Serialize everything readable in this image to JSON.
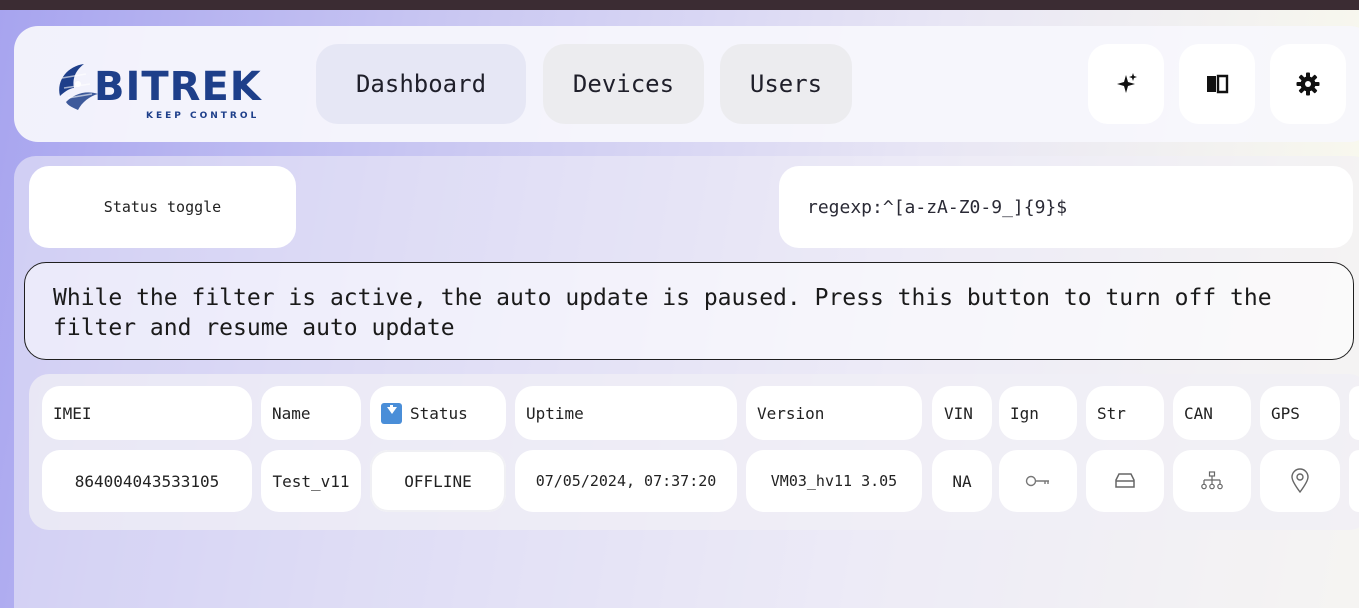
{
  "app": {
    "logo_text": "BITREK",
    "logo_tagline": "KEEP CONTROL",
    "brand_color": "#1e3f8a"
  },
  "nav": {
    "dashboard_label": "Dashboard",
    "devices_label": "Devices",
    "users_label": "Users",
    "icons": [
      "sparkle-icon",
      "book-icon",
      "gear-icon"
    ]
  },
  "filters": {
    "status_toggle_label": "Status toggle",
    "search_value": "regexp:^[a-zA-Z0-9_]{9}$"
  },
  "notice": {
    "text": "While the filter is active, the auto update is paused. Press this button to turn off the filter and resume auto update"
  },
  "table": {
    "headers": {
      "imei": "IMEI",
      "name": "Name",
      "status": "Status",
      "uptime": "Uptime",
      "version": "Version",
      "vin": "VIN",
      "ign": "Ign",
      "str": "Str",
      "can": "CAN",
      "gps": "GPS"
    },
    "rows": [
      {
        "imei": "864004043533105",
        "name": "Test_v11",
        "status": "OFFLINE",
        "uptime": "07/05/2024, 07:37:20",
        "version": "VM03_hv11 3.05",
        "vin": "NA",
        "ign_icon": "key-icon",
        "str_icon": "storage-icon",
        "can_icon": "network-icon",
        "gps_icon": "location-pin-icon"
      }
    ],
    "sort_indicator": "sort-down-icon",
    "sort_color": "#4a8ed8"
  }
}
